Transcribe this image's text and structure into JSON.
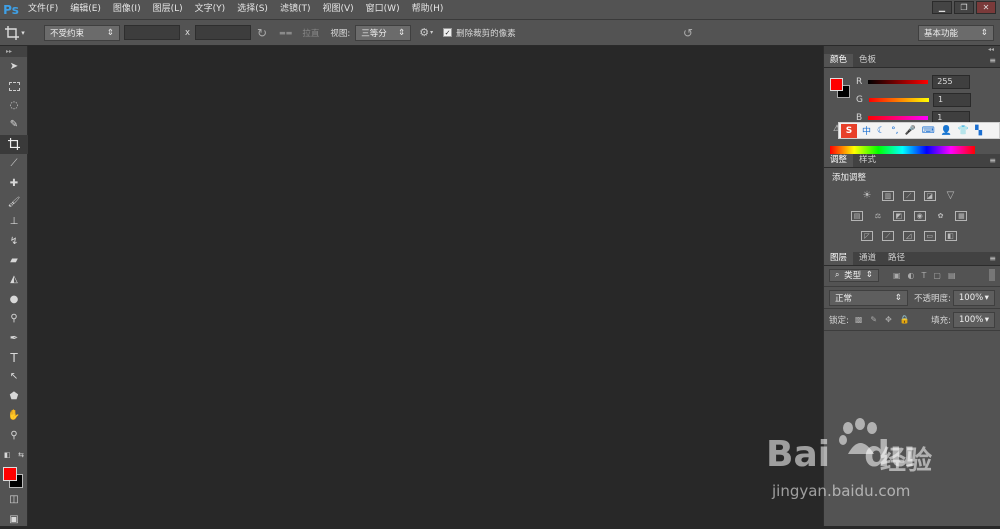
{
  "app": {
    "logo": "Ps"
  },
  "menu": [
    "文件(F)",
    "编辑(E)",
    "图像(I)",
    "图层(L)",
    "文字(Y)",
    "选择(S)",
    "滤镜(T)",
    "视图(V)",
    "窗口(W)",
    "帮助(H)"
  ],
  "window_controls": {
    "minimize": "▁",
    "restore": "❐",
    "close": "✕"
  },
  "options_bar": {
    "ratio_dropdown": "不受约束",
    "x_label": "x",
    "straighten_label": "拉直",
    "view_label": "视图:",
    "view_dropdown": "三等分",
    "delete_pixels_label": "删除裁剪的像素",
    "delete_pixels_checked": true,
    "workspace": "基本功能"
  },
  "color_panel": {
    "tabs": [
      "颜色",
      "色板"
    ],
    "rows": [
      {
        "label": "R",
        "value": "255",
        "color": "#ff0000"
      },
      {
        "label": "G",
        "value": "1",
        "color": "#00ff00"
      },
      {
        "label": "B",
        "value": "1",
        "color": "#0000ff"
      }
    ],
    "foreground": "#ff0000",
    "background": "#000000"
  },
  "adjust_panel": {
    "tabs": [
      "调整",
      "样式"
    ],
    "title": "添加调整"
  },
  "layers_panel": {
    "tabs": [
      "图层",
      "通道",
      "路径"
    ],
    "filter_type": "类型",
    "blend_mode": "正常",
    "opacity_label": "不透明度:",
    "opacity_value": "100%",
    "lock_label": "锁定:",
    "fill_label": "填充:",
    "fill_value": "100%"
  },
  "ime": {
    "logo": "S",
    "lang": "中"
  },
  "watermark": {
    "brand": "Bai",
    "brand_tail": "du",
    "cn": "经验",
    "url": "jingyan.baidu.com"
  },
  "accent": "#ff0000"
}
